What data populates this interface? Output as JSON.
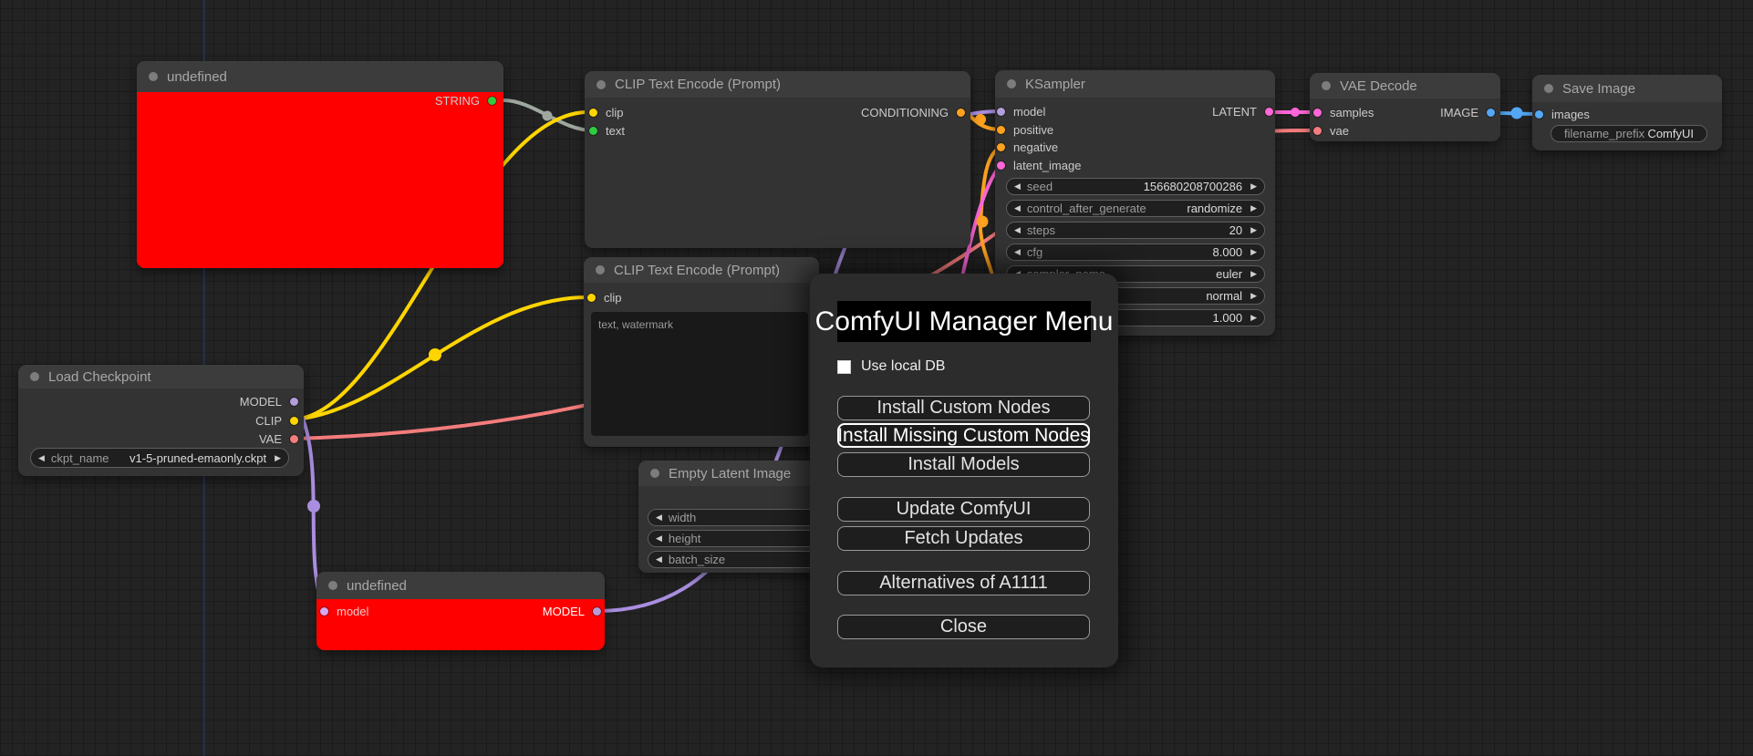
{
  "icons": {
    "left_arrow": "◀",
    "right_arrow": "▶"
  },
  "colors": {
    "canvas_bg": "#232323",
    "node_body": "#333333",
    "node_title": "#3c3c3c",
    "error_node_body": "#ff0000",
    "wire_string": "#9fa89f",
    "wire_clip": "#ffd500",
    "wire_conditioning": "#ffa21f",
    "wire_model": "#b39ddb",
    "wire_latent": "#ff66d8",
    "wire_vae": "#f47c7c",
    "wire_image": "#53a7f5",
    "axis_line": "#27365c"
  },
  "nodes": {
    "undefined_top": {
      "title": "undefined",
      "output": "STRING"
    },
    "clip_encode_1": {
      "title": "CLIP Text Encode (Prompt)",
      "inputs": [
        {
          "name": "clip"
        },
        {
          "name": "text"
        }
      ],
      "output": "CONDITIONING"
    },
    "clip_encode_2": {
      "title": "CLIP Text Encode (Prompt)",
      "inputs": [
        {
          "name": "clip"
        }
      ],
      "text_value": "text, watermark"
    },
    "ksampler": {
      "title": "KSampler",
      "inputs": [
        {
          "name": "model"
        },
        {
          "name": "positive"
        },
        {
          "name": "negative"
        },
        {
          "name": "latent_image"
        }
      ],
      "output": "LATENT",
      "widgets": [
        {
          "label": "seed",
          "value": "156680208700286"
        },
        {
          "label": "control_after_generate",
          "value": "randomize"
        },
        {
          "label": "steps",
          "value": "20"
        },
        {
          "label": "cfg",
          "value": "8.000"
        },
        {
          "label": "sampler_name",
          "value": "euler"
        },
        {
          "label": "",
          "value": "normal"
        },
        {
          "label": "",
          "value": "1.000"
        }
      ]
    },
    "vae_decode": {
      "title": "VAE Decode",
      "inputs": [
        {
          "name": "samples"
        },
        {
          "name": "vae"
        }
      ],
      "output": "IMAGE"
    },
    "save_image": {
      "title": "Save Image",
      "inputs": [
        {
          "name": "images"
        }
      ],
      "widgets": [
        {
          "label": "filename_prefix",
          "value": "ComfyUI"
        }
      ]
    },
    "load_checkpoint": {
      "title": "Load Checkpoint",
      "outputs": [
        {
          "name": "MODEL"
        },
        {
          "name": "CLIP"
        },
        {
          "name": "VAE"
        }
      ],
      "widgets": [
        {
          "label": "ckpt_name",
          "value": "v1-5-pruned-emaonly.ckpt"
        }
      ]
    },
    "empty_latent": {
      "title": "Empty Latent Image",
      "widgets": [
        {
          "label": "width",
          "value": ""
        },
        {
          "label": "height",
          "value": ""
        },
        {
          "label": "batch_size",
          "value": ""
        }
      ]
    },
    "undefined_bottom": {
      "title": "undefined",
      "input": "model",
      "output": "MODEL"
    }
  },
  "modal": {
    "title": "ComfyUI Manager Menu",
    "checkbox_label": "Use local DB",
    "buttons": [
      "Install Custom Nodes",
      "Install Missing Custom Nodes",
      "Install Models",
      "Update ComfyUI",
      "Fetch Updates",
      "Alternatives of A1111",
      "Close"
    ]
  }
}
